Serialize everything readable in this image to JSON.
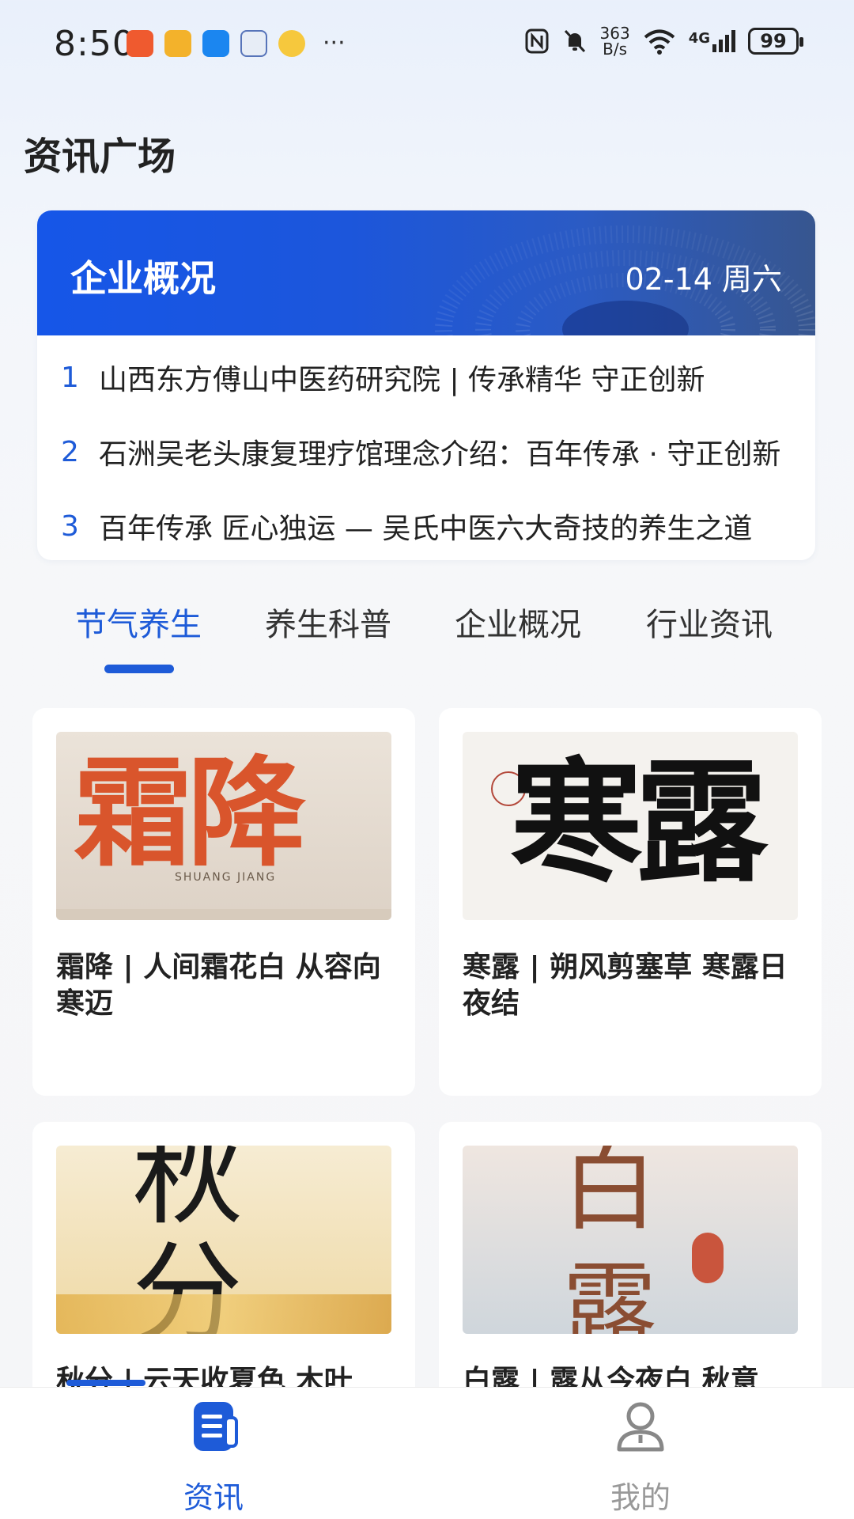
{
  "status_bar": {
    "time": "8:50",
    "speed_top": "363",
    "speed_bottom": "B/s",
    "network": "4G",
    "battery": "99"
  },
  "page": {
    "title": "资讯广场"
  },
  "banner": {
    "title": "企业概况",
    "date": "02-14 周六",
    "items": [
      {
        "num": "1",
        "text": "山西东方傅山中医药研究院 | 传承精华 守正创新"
      },
      {
        "num": "2",
        "text": "石洲吴老头康复理疗馆理念介绍：百年传承 · 守正创新"
      },
      {
        "num": "3",
        "text": "百年传承 匠心独运 — 吴氏中医六大奇技的养生之道"
      }
    ]
  },
  "tabs": [
    {
      "label": "节气养生",
      "active": true
    },
    {
      "label": "养生科普",
      "active": false
    },
    {
      "label": "企业概况",
      "active": false
    },
    {
      "label": "行业资讯",
      "active": false
    }
  ],
  "articles": [
    {
      "title": "霜降 | 人间霜花白 从容向寒迈",
      "image_text": "霜降",
      "image_sub": "SHUANG JIANG"
    },
    {
      "title": "寒露 | 朔风剪塞草 寒露日夜结",
      "image_text": "寒露"
    },
    {
      "title": "秋分 | 云天收夏色 木叶",
      "image_text": "秋分"
    },
    {
      "title": "白露 | 露从今夜白 秋意",
      "image_text": "白露"
    }
  ],
  "bottom_nav": [
    {
      "label": "资讯",
      "icon": "news-icon",
      "active": true
    },
    {
      "label": "我的",
      "icon": "user-icon",
      "active": false
    }
  ],
  "colors": {
    "accent": "#1e5bd8",
    "banner_start": "#1656e8",
    "banner_end": "#37568f"
  }
}
